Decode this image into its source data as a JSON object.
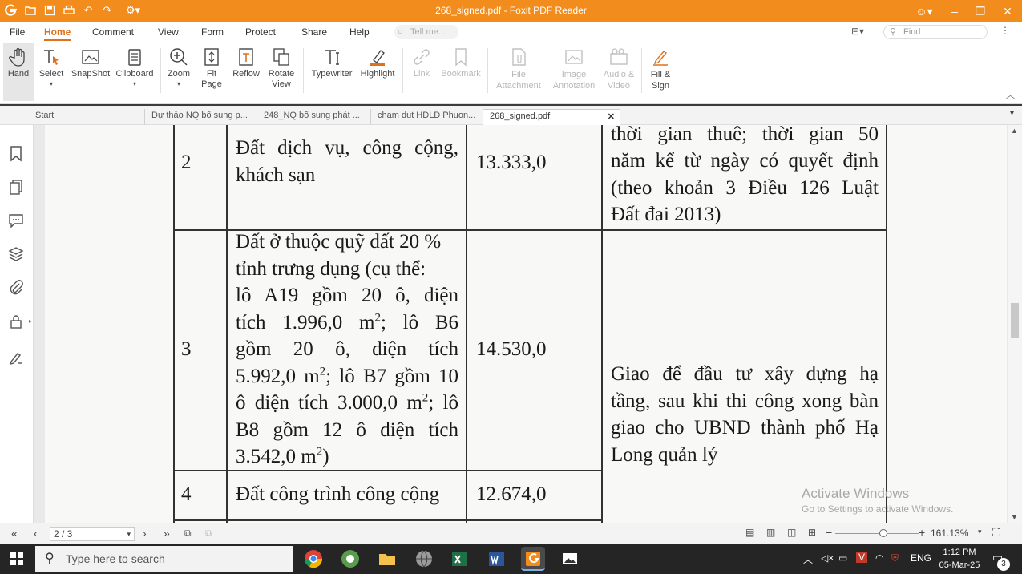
{
  "window": {
    "title": "268_signed.pdf - Foxit PDF Reader",
    "accent": "#f28c1c"
  },
  "menu": {
    "items": [
      "File",
      "Home",
      "Comment",
      "View",
      "Form",
      "Protect",
      "Share",
      "Help"
    ],
    "active": "Home",
    "tell_me": "Tell me...",
    "find_placeholder": "Find"
  },
  "ribbon": {
    "hand": "Hand",
    "select": "Select",
    "snapshot": "SnapShot",
    "clipboard": "Clipboard",
    "zoom": "Zoom",
    "fit_page": "Fit Page",
    "reflow": "Reflow",
    "rotate_view": "Rotate View",
    "typewriter": "Typewriter",
    "highlight": "Highlight",
    "link": "Link",
    "bookmark": "Bookmark",
    "file_attachment": "File Attachment",
    "image_annotation": "Image Annotation",
    "audio_video": "Audio & Video",
    "fill_sign": "Fill & Sign"
  },
  "tabs": [
    "Start",
    "Dự thảo NQ bổ sung p...",
    "248_NQ bổ sung phát ...",
    "cham dut HDLD Phuon...",
    "268_signed.pdf"
  ],
  "document": {
    "rows": [
      {
        "no": "2",
        "name_lines": [
          "Đất dịch vụ, công cộng,",
          "khách sạn"
        ],
        "area": "13.333,0"
      },
      {
        "no": "3",
        "name_lines": [
          "Đất ở thuộc quỹ đất 20 %",
          "tỉnh trưng dụng  (cụ thể:",
          "lô A19 gồm 20 ô, diện",
          "tích 1.996,0 m",
          "gồm 20 ô, diện tích",
          "5.992,0 m",
          "ô diện tích 3.000,0 m",
          "B8 gồm 12 ô diện tích",
          "3.542,0 m"
        ],
        "area": "14.530,0"
      },
      {
        "no": "4",
        "name": "Đất công trình công cộng",
        "area": "12.674,0"
      }
    ],
    "line4_tail": "; lô B6",
    "line6_tail": "; lô B7 gồm 10",
    "line7_tail": "; lô",
    "line9_tail": ")",
    "sup": "2",
    "note_top": [
      "thời gian thuê; thời gian 50",
      "năm kể từ ngày có quyết định",
      "(theo khoản 3 Điều 126 Luật",
      "Đất đai 2013)"
    ],
    "note_bottom": [
      "Giao để đầu tư xây dựng hạ",
      "tầng, sau khi thi công xong bàn",
      "giao cho UBND thành phố Hạ",
      "Long quản lý"
    ]
  },
  "watermark": {
    "line1": "Activate Windows",
    "line2": "Go to Settings to activate Windows."
  },
  "status": {
    "page": "2 / 3",
    "zoom": "161.13%"
  },
  "taskbar": {
    "search": "Type here to search",
    "lang": "ENG",
    "time": "1:12 PM",
    "date": "05-Mar-25",
    "notif": "3"
  }
}
